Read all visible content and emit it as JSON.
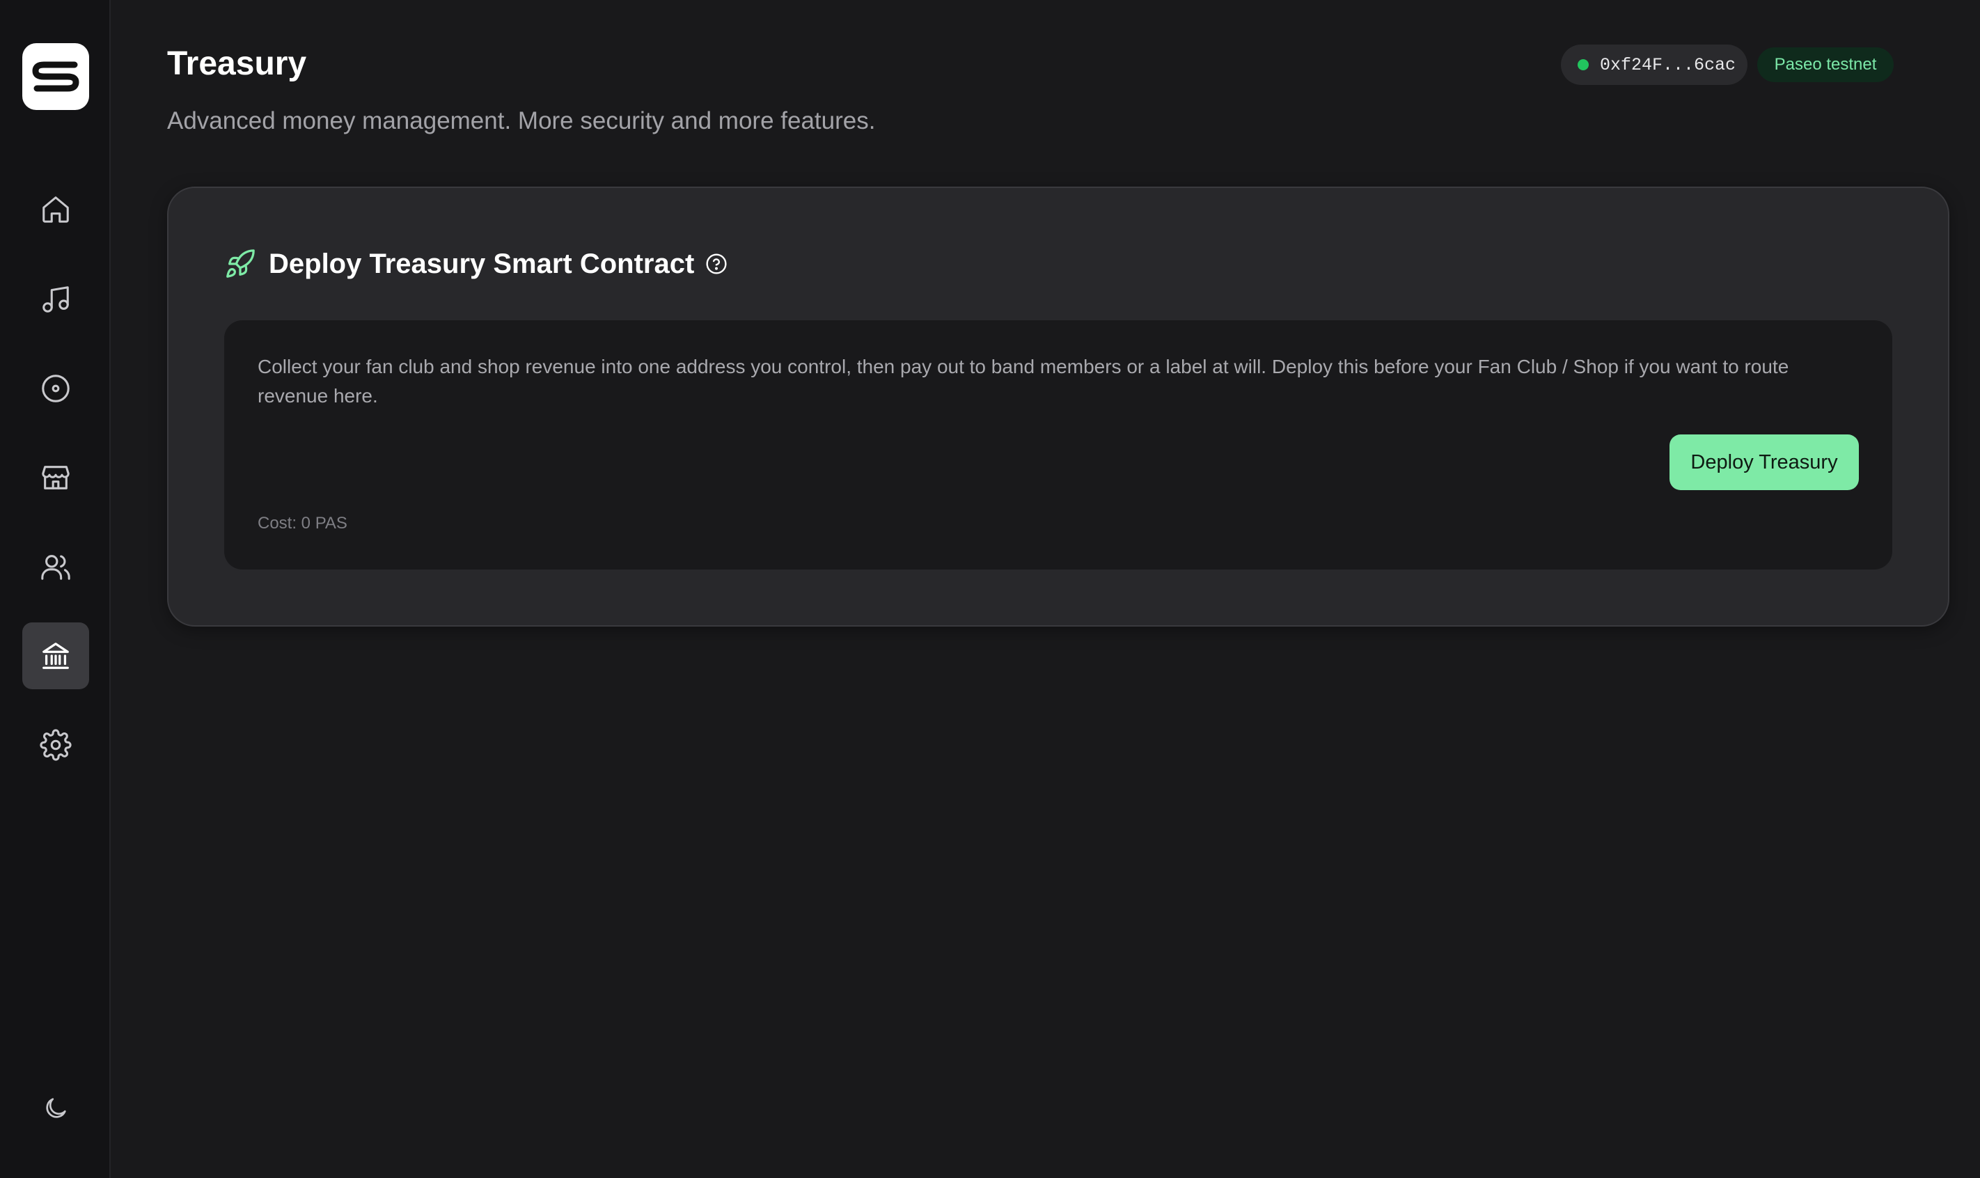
{
  "page": {
    "title": "Treasury",
    "subtitle": "Advanced money management. More security and more features."
  },
  "sidebar": {
    "items": [
      {
        "name": "home",
        "icon": "home-icon",
        "active": false
      },
      {
        "name": "music",
        "icon": "music-note-icon",
        "active": false
      },
      {
        "name": "releases",
        "icon": "disc-icon",
        "active": false
      },
      {
        "name": "shop",
        "icon": "store-icon",
        "active": false
      },
      {
        "name": "fan-club",
        "icon": "users-icon",
        "active": false
      },
      {
        "name": "treasury",
        "icon": "bank-icon",
        "active": true
      },
      {
        "name": "settings",
        "icon": "gear-icon",
        "active": false
      }
    ],
    "theme_toggle_icon": "moon-icon"
  },
  "header": {
    "wallet_address": "0xf24F...6cac",
    "wallet_status_color": "#22c55e",
    "network": "Paseo testnet"
  },
  "card": {
    "title": "Deploy Treasury Smart Contract",
    "description": "Collect your fan club and shop revenue into one address you control, then pay out to band members or a label at will. Deploy this before your Fan Club / Shop if you want to route revenue here.",
    "button_label": "Deploy Treasury",
    "cost": "Cost: 0 PAS"
  },
  "colors": {
    "accent": "#7eeaa6",
    "background": "#19191b",
    "card": "#28282b"
  }
}
